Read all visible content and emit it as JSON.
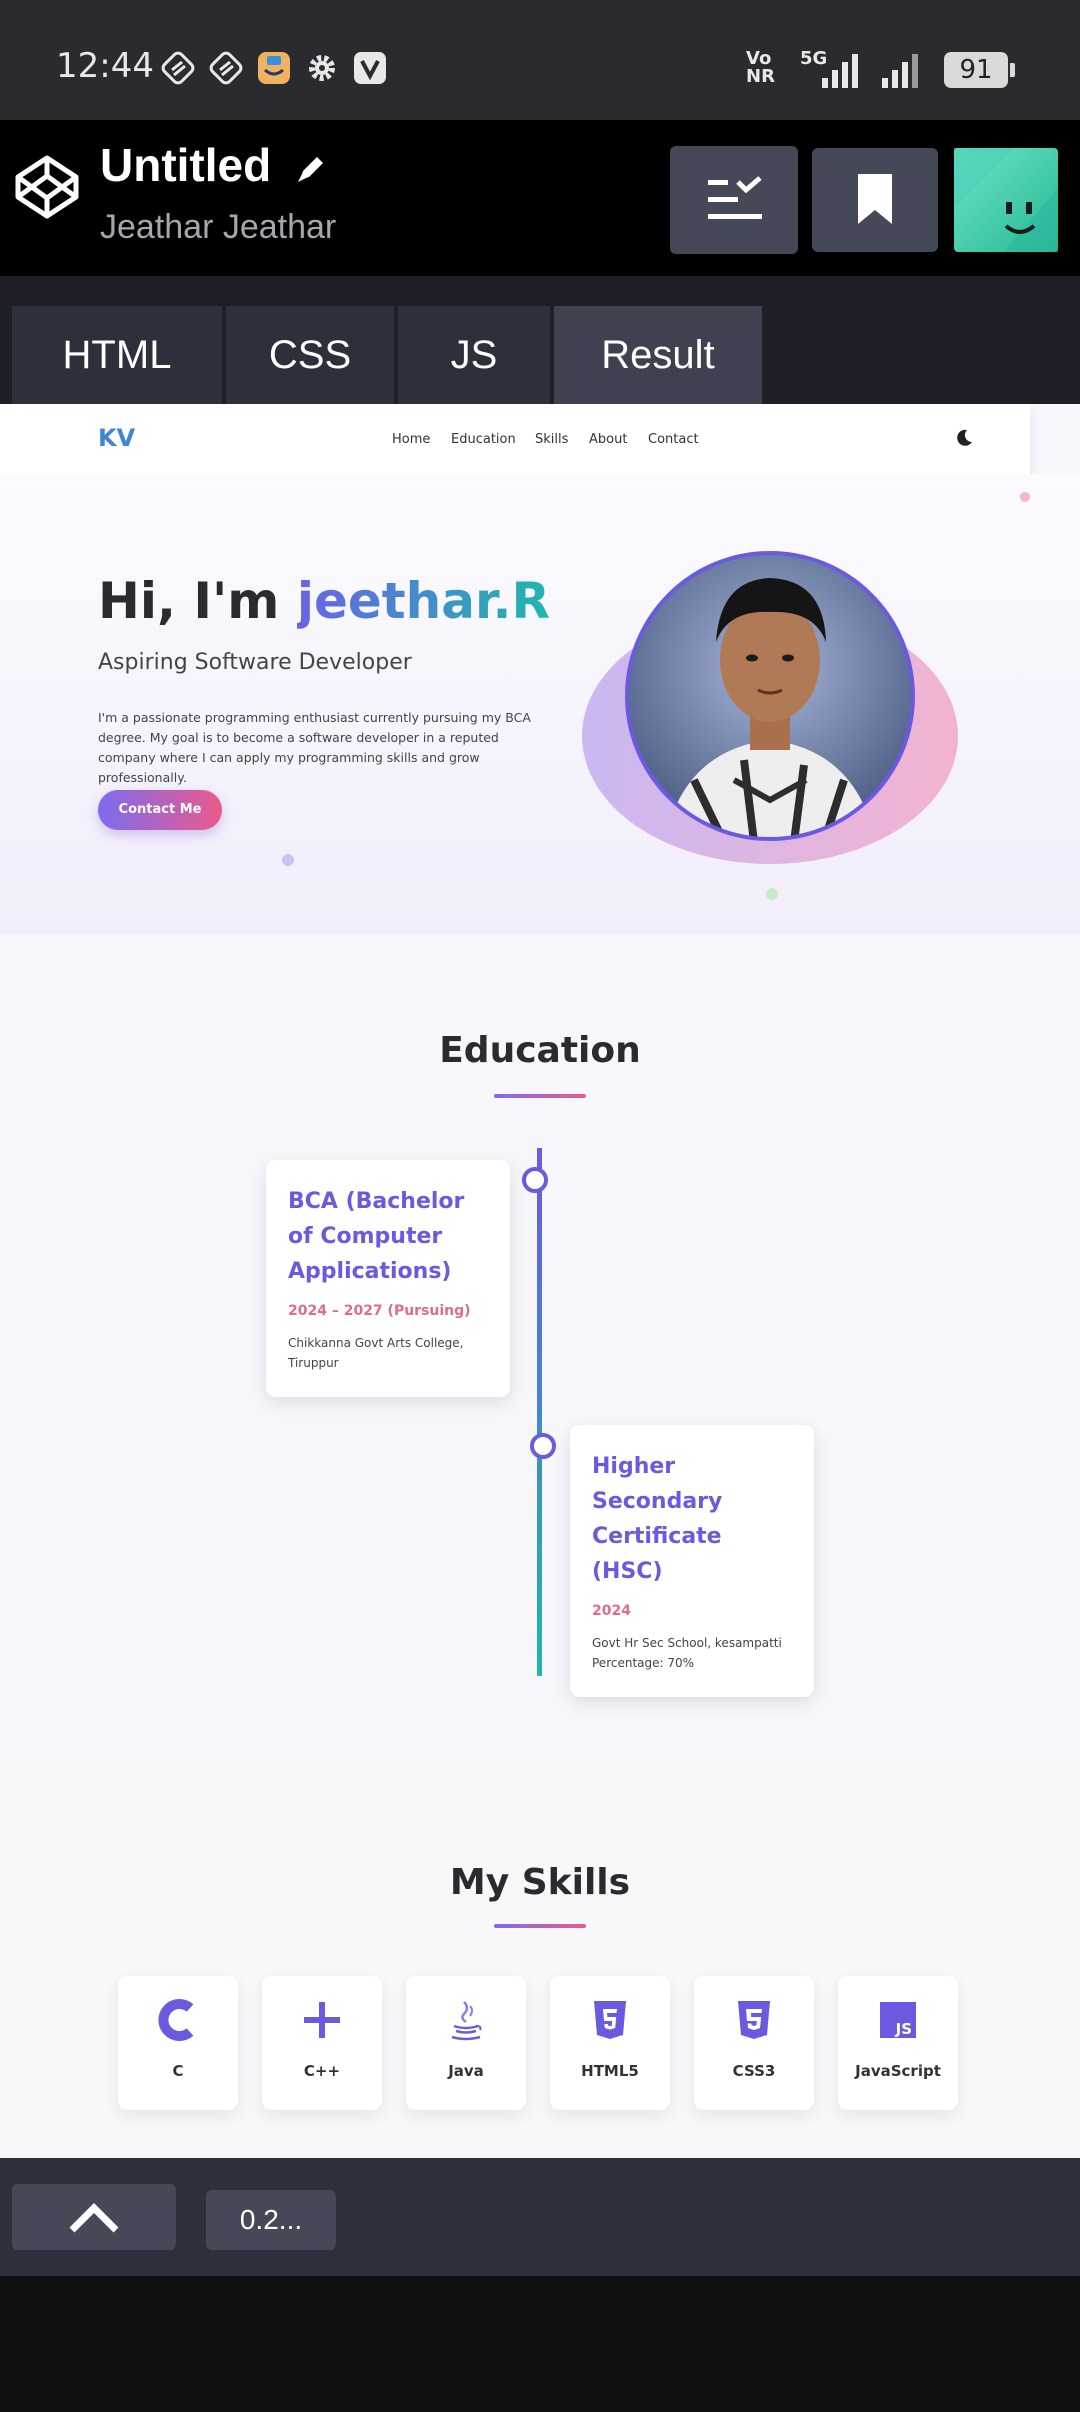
{
  "status_bar": {
    "time": "12:44",
    "network_label": "Vo NR",
    "network_type": "5G",
    "battery": "91",
    "icons": [
      "vpn-icon",
      "vpn-icon",
      "shopping-app-icon",
      "gear-icon",
      "v-app-icon",
      "signal-icon",
      "signal-icon"
    ]
  },
  "codepen": {
    "title": "Untitled",
    "author": "Jeathar Jeathar",
    "tabs": [
      {
        "label": "HTML"
      },
      {
        "label": "CSS"
      },
      {
        "label": "JS"
      },
      {
        "label": "Result"
      }
    ],
    "active_tab": "Result",
    "version_label": "0.2..."
  },
  "site": {
    "logo": "KV",
    "nav": [
      "Home",
      "Education",
      "Skills",
      "About",
      "Contact"
    ],
    "hero": {
      "greeting": "Hi, I'm ",
      "name": "jeethar.R",
      "subtitle": "Aspiring Software Developer",
      "description": "I'm a passionate programming enthusiast currently pursuing my BCA degree. My goal is to become a software developer in a reputed company where I can apply my programming skills and grow professionally.",
      "button": "Contact Me"
    },
    "education": {
      "title": "Education",
      "items": [
        {
          "title": "BCA (Bachelor of Computer Applications)",
          "years": "2024 – 2027 (Pursuing)",
          "body": "Chikkanna Govt Arts College, Tiruppur"
        },
        {
          "title": "Higher Secondary Certificate (HSC)",
          "years": "2024",
          "body": "Govt Hr Sec School, kesampatti Percentage: 70%"
        }
      ]
    },
    "skills": {
      "title": "My Skills",
      "items": [
        {
          "label": "C"
        },
        {
          "label": "C++"
        },
        {
          "label": "Java"
        },
        {
          "label": "HTML5"
        },
        {
          "label": "CSS3"
        },
        {
          "label": "JavaScript"
        }
      ]
    }
  },
  "colors": {
    "accent": "#6a5ae0",
    "pink": "#ec5a8b",
    "teal": "#1fb7ad",
    "codepen_bg": "#000000",
    "tab_bg": "#2c303a"
  }
}
